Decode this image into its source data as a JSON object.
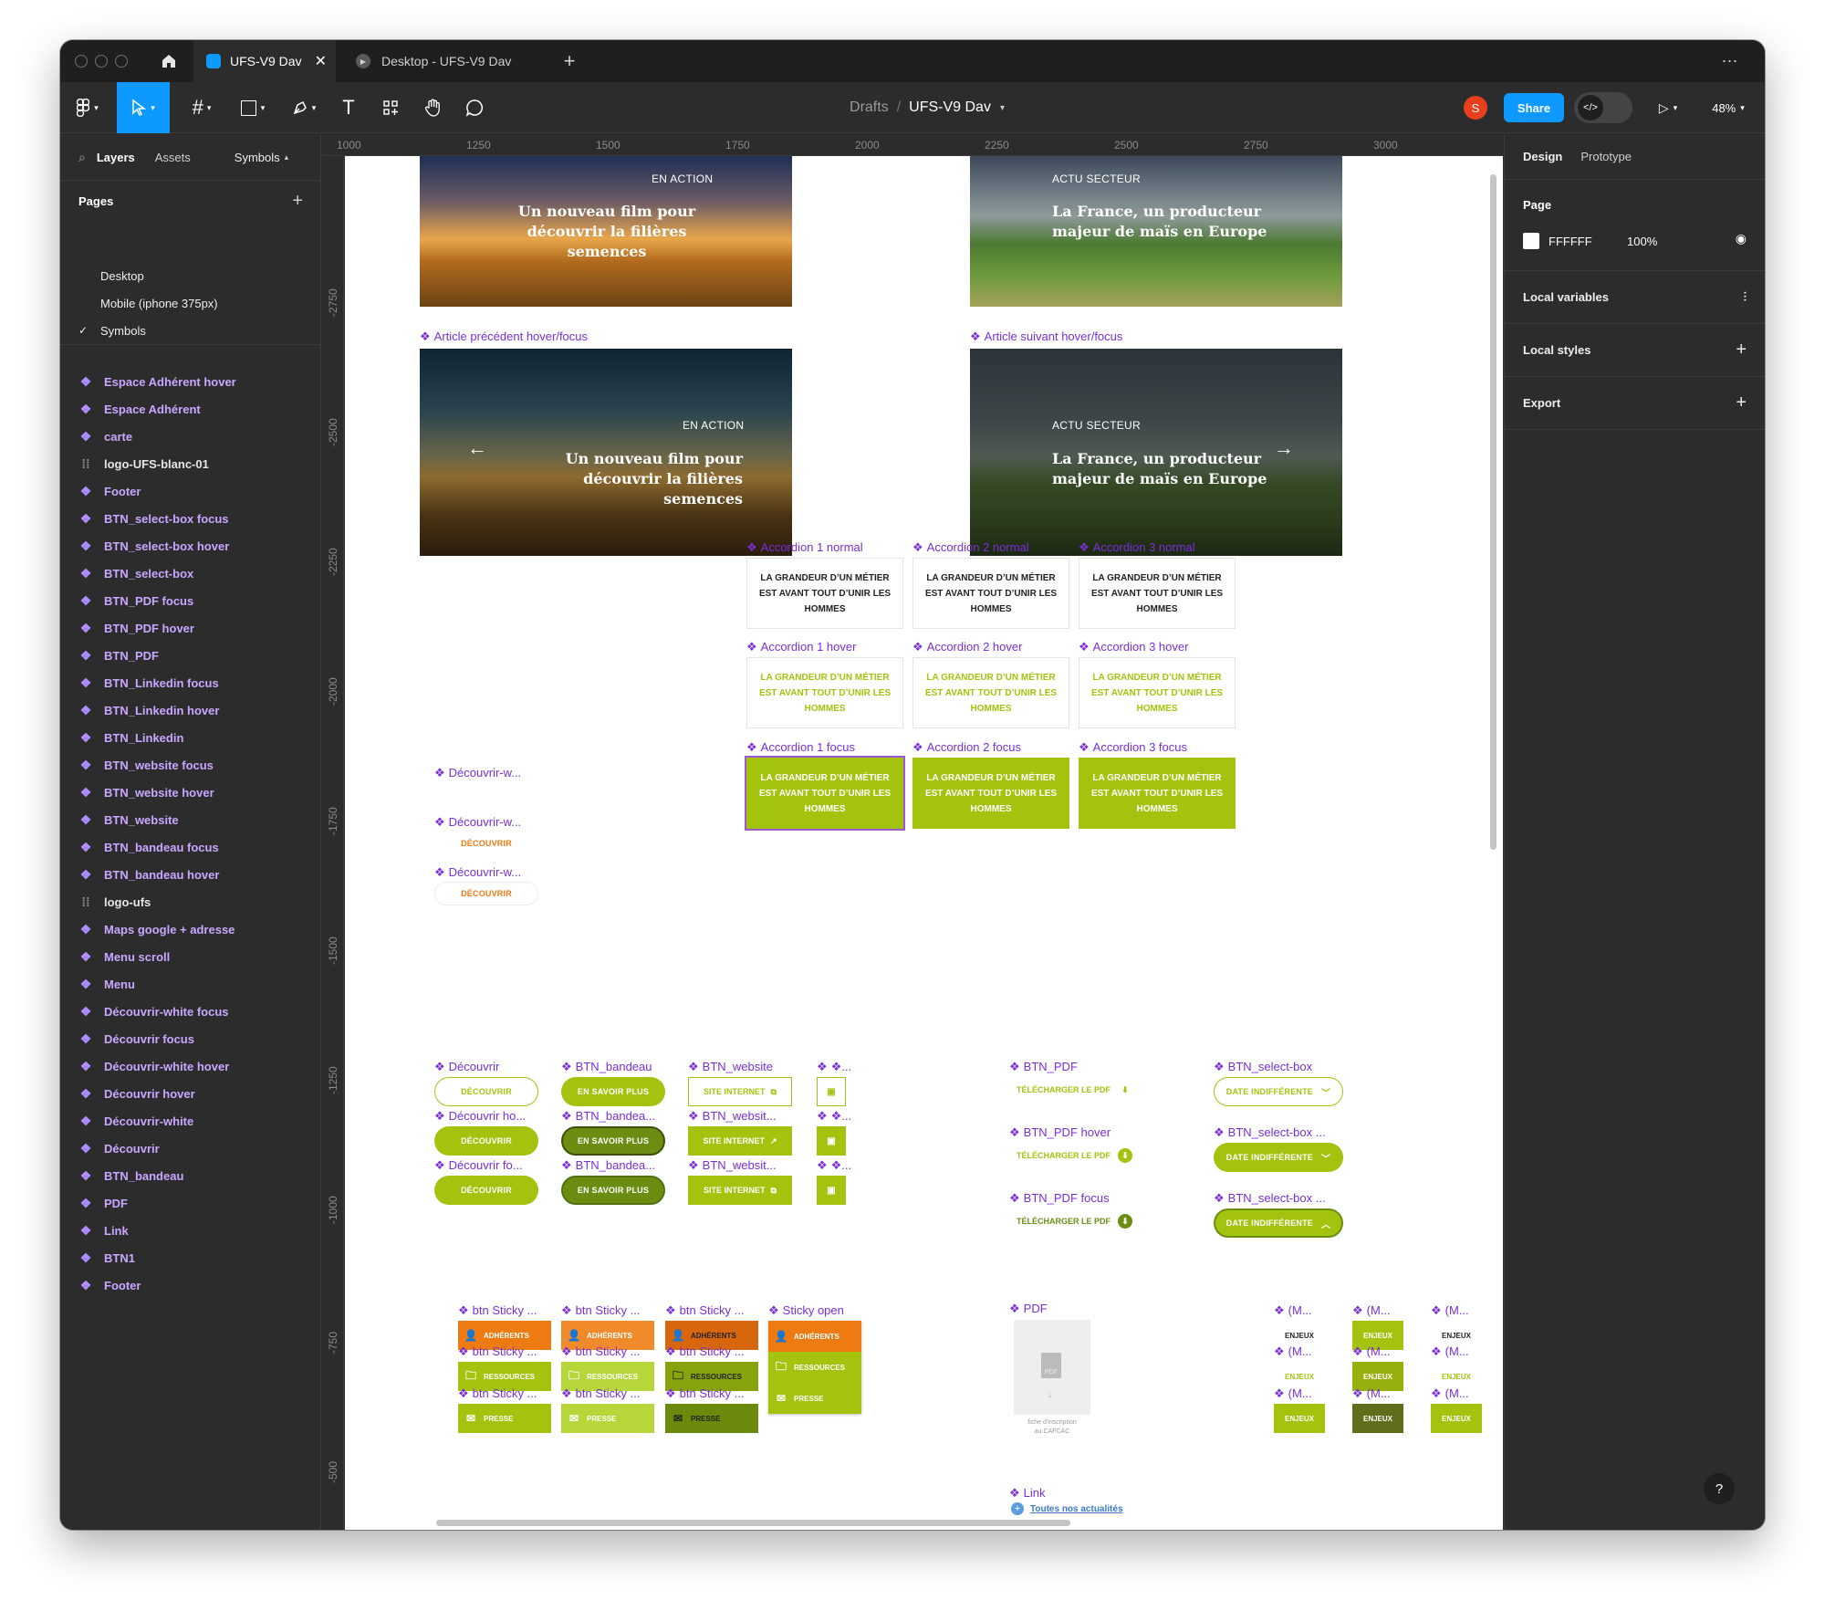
{
  "tabs": [
    {
      "label": "UFS-V9 Dav"
    },
    {
      "label": "Desktop - UFS-V9 Dav"
    }
  ],
  "toolbar": {
    "breadcrumb_root": "Drafts",
    "breadcrumb_sep": "/",
    "file_name": "UFS-V9 Dav",
    "avatar_initial": "S",
    "share_label": "Share",
    "zoom": "48%"
  },
  "left": {
    "tabs": {
      "layers": "Layers",
      "assets": "Assets",
      "symbols": "Symbols"
    },
    "pages_title": "Pages",
    "pages": [
      {
        "label": "Desktop"
      },
      {
        "label": "Mobile (iphone 375px)"
      },
      {
        "label": "Symbols",
        "current": true
      }
    ],
    "layers": [
      {
        "label": "Espace Adhérent hover",
        "type": "component"
      },
      {
        "label": "Espace Adhérent",
        "type": "component"
      },
      {
        "label": "carte",
        "type": "component"
      },
      {
        "label": "logo-UFS-blanc-01",
        "type": "frame"
      },
      {
        "label": "Footer",
        "type": "component"
      },
      {
        "label": "BTN_select-box focus",
        "type": "component"
      },
      {
        "label": "BTN_select-box hover",
        "type": "component"
      },
      {
        "label": "BTN_select-box",
        "type": "component"
      },
      {
        "label": "BTN_PDF focus",
        "type": "component"
      },
      {
        "label": "BTN_PDF hover",
        "type": "component"
      },
      {
        "label": "BTN_PDF",
        "type": "component"
      },
      {
        "label": "BTN_Linkedin focus",
        "type": "component"
      },
      {
        "label": "BTN_Linkedin hover",
        "type": "component"
      },
      {
        "label": "BTN_Linkedin",
        "type": "component"
      },
      {
        "label": "BTN_website focus",
        "type": "component"
      },
      {
        "label": "BTN_website hover",
        "type": "component"
      },
      {
        "label": "BTN_website",
        "type": "component"
      },
      {
        "label": "BTN_bandeau focus",
        "type": "component"
      },
      {
        "label": "BTN_bandeau hover",
        "type": "component"
      },
      {
        "label": "logo-ufs",
        "type": "frame"
      },
      {
        "label": "Maps google + adresse",
        "type": "component"
      },
      {
        "label": "Menu scroll",
        "type": "component"
      },
      {
        "label": "Menu",
        "type": "component"
      },
      {
        "label": "Découvrir-white focus",
        "type": "component"
      },
      {
        "label": "Découvrir focus",
        "type": "component"
      },
      {
        "label": "Découvrir-white hover",
        "type": "component"
      },
      {
        "label": "Découvrir hover",
        "type": "component"
      },
      {
        "label": "Découvrir-white",
        "type": "component"
      },
      {
        "label": "Découvrir",
        "type": "component"
      },
      {
        "label": "BTN_bandeau",
        "type": "component"
      },
      {
        "label": "PDF",
        "type": "component"
      },
      {
        "label": "Link",
        "type": "component"
      },
      {
        "label": "BTN1",
        "type": "component"
      },
      {
        "label": "Footer",
        "type": "component"
      }
    ]
  },
  "right": {
    "tabs": {
      "design": "Design",
      "prototype": "Prototype"
    },
    "page_title": "Page",
    "page_color": "FFFFFF",
    "page_opacity": "100%",
    "local_variables": "Local variables",
    "local_styles": "Local styles",
    "export": "Export"
  },
  "ruler": {
    "top": [
      "1000",
      "1250",
      "1500",
      "1750",
      "2000",
      "2250",
      "2500",
      "2750",
      "3000"
    ],
    "left": [
      "-2750",
      "-2500",
      "-2250",
      "-2000",
      "-1750",
      "-1500",
      "-1250",
      "-1000",
      "-750",
      "-500"
    ]
  },
  "canvas": {
    "cards_top": [
      {
        "category": "EN ACTION",
        "title_l1": "Un nouveau film pour",
        "title_l2": "découvrir la filières semences"
      },
      {
        "category": "ACTU SECTEUR",
        "title_l1": "La France, un producteur",
        "title_l2": "majeur de maïs en Europe"
      }
    ],
    "cards_hover": [
      {
        "frame_label": "Article précédent hover/focus",
        "category": "EN ACTION",
        "title_l1": "Un nouveau film pour",
        "title_l2": "découvrir la filières semences",
        "arrow": "←"
      },
      {
        "frame_label": "Article suivant hover/focus",
        "category": "ACTU SECTEUR",
        "title_l1": "La France, un producteur",
        "title_l2": "majeur de maïs en Europe",
        "arrow": "→"
      }
    ],
    "accordion_text": "LA GRANDEUR D’UN MÉTIER EST AVANT TOUT D’UNIR LES HOMMES",
    "accordion_labels": [
      "Accordion 1 normal",
      "Accordion 2 normal",
      "Accordion 3 normal",
      "Accordion 1 hover",
      "Accordion 2 hover",
      "Accordion 3 hover",
      "Accordion 1 focus",
      "Accordion 2 focus",
      "Accordion 3 focus"
    ],
    "decouvrir_white": {
      "labels": [
        "Découvrir-w...",
        "Découvrir-w...",
        "Découvrir-w..."
      ],
      "btn": "DÉCOUVRIR"
    },
    "btn_labels": {
      "decouvrir": [
        "Découvrir",
        "Découvrir ho...",
        "Découvrir fo..."
      ],
      "bandeau": [
        "BTN_bandeau",
        "BTN_bandea...",
        "BTN_bandea..."
      ],
      "website": [
        "BTN_website",
        "BTN_websit...",
        "BTN_websit..."
      ],
      "linkedin": [
        "❖...",
        "❖...",
        "❖..."
      ]
    },
    "btn_text": {
      "decouvrir": "DÉCOUVRIR",
      "bandeau": "EN SAVOIR PLUS",
      "website": "SITE INTERNET"
    },
    "pdf_btn": {
      "labels": [
        "BTN_PDF",
        "BTN_PDF hover",
        "BTN_PDF focus"
      ],
      "text": "TÉLÉCHARGER LE PDF"
    },
    "select_box": {
      "labels": [
        "BTN_select-box",
        "BTN_select-box ...",
        "BTN_select-box ..."
      ],
      "text": "DATE INDIFFÉRENTE"
    },
    "sticky": {
      "labels": [
        "btn Sticky ...",
        "btn Sticky ...",
        "btn Sticky ..."
      ],
      "open_label": "Sticky open",
      "items": [
        "ADHÉRENTS",
        "RESSOURCES",
        "PRESSE"
      ]
    },
    "pdf": {
      "label": "PDF",
      "icon_text": "PDF",
      "caption_l1": "fiche d'inscription",
      "caption_l2": "au CAFCAC"
    },
    "link": {
      "label": "Link",
      "text": "Toutes nos actualités"
    },
    "enjeux": {
      "label": "(M...",
      "text": "ENJEUX"
    }
  },
  "colors": {
    "green": "#a4c30f",
    "dark_green": "#6b8e12",
    "orange": "#ee7a12",
    "purple": "#7a2fd9",
    "blue": "#0d99ff"
  }
}
